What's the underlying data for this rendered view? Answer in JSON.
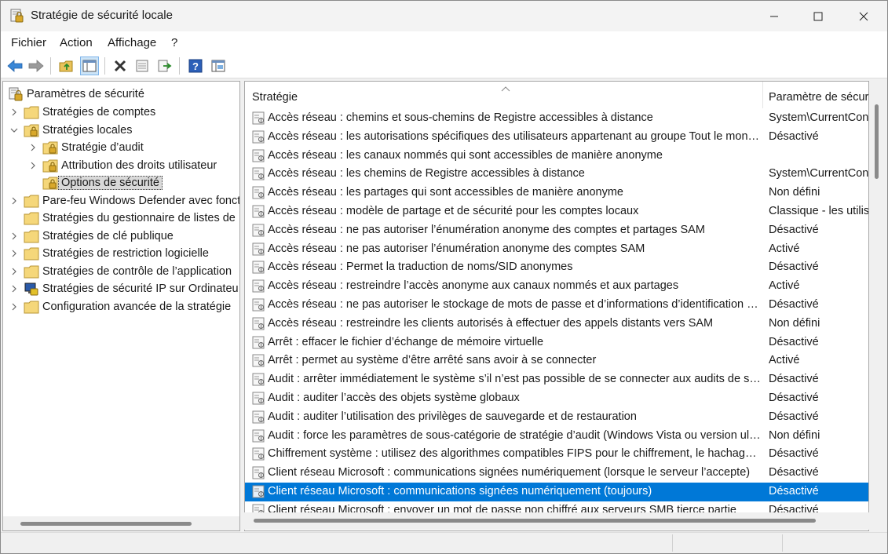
{
  "window": {
    "title": "Stratégie de sécurité locale"
  },
  "menu": [
    "Fichier",
    "Action",
    "Affichage",
    "?"
  ],
  "toolbar": {
    "buttons": [
      "back-arrow-icon",
      "forward-arrow-icon",
      "up-folder-icon",
      "show-hide-tree-icon",
      "delete-icon",
      "properties-icon",
      "export-list-icon",
      "help-icon",
      "console-icon"
    ]
  },
  "tree": {
    "root": "Paramètres de sécurité",
    "items": [
      {
        "label": "Stratégies de comptes",
        "level": 1,
        "expander": "collapsed"
      },
      {
        "label": "Stratégies locales",
        "level": 1,
        "expander": "expanded"
      },
      {
        "label": "Stratégie d’audit",
        "level": 2,
        "expander": "collapsed"
      },
      {
        "label": "Attribution des droits utilisateur",
        "level": 2,
        "expander": "collapsed"
      },
      {
        "label": "Options de sécurité",
        "level": 2,
        "expander": "none",
        "selected": true
      },
      {
        "label": "Pare-feu Windows Defender avec fonct",
        "level": 1,
        "expander": "collapsed"
      },
      {
        "label": "Stratégies du gestionnaire de listes de",
        "level": 1,
        "expander": "none"
      },
      {
        "label": "Stratégies de clé publique",
        "level": 1,
        "expander": "collapsed"
      },
      {
        "label": "Stratégies de restriction logicielle",
        "level": 1,
        "expander": "collapsed"
      },
      {
        "label": "Stratégies de contrôle de l’application",
        "level": 1,
        "expander": "collapsed"
      },
      {
        "label": "Stratégies de sécurité IP sur Ordinateu",
        "level": 1,
        "expander": "collapsed"
      },
      {
        "label": "Configuration avancée de la stratégie",
        "level": 1,
        "expander": "collapsed"
      }
    ]
  },
  "list": {
    "columns": [
      "Stratégie",
      "Paramètre de sécurité"
    ],
    "rows": [
      {
        "policy": "Accès réseau : chemins et sous-chemins de Registre accessibles à distance",
        "setting": "System\\CurrentCont"
      },
      {
        "policy": "Accès réseau : les autorisations spécifiques des utilisateurs appartenant au groupe Tout le mon…",
        "setting": "Désactivé"
      },
      {
        "policy": "Accès réseau : les canaux nommés qui sont accessibles de manière anonyme",
        "setting": ""
      },
      {
        "policy": "Accès réseau : les chemins de Registre accessibles à distance",
        "setting": "System\\CurrentCont"
      },
      {
        "policy": "Accès réseau : les partages qui sont accessibles de manière anonyme",
        "setting": "Non défini"
      },
      {
        "policy": "Accès réseau : modèle de partage et de sécurité pour les comptes locaux",
        "setting": "Classique - les utilis"
      },
      {
        "policy": "Accès réseau : ne pas autoriser l’énumération anonyme des comptes et partages SAM",
        "setting": "Désactivé"
      },
      {
        "policy": "Accès réseau : ne pas autoriser l’énumération anonyme des comptes SAM",
        "setting": "Activé"
      },
      {
        "policy": "Accès réseau : Permet la traduction de noms/SID anonymes",
        "setting": "Désactivé"
      },
      {
        "policy": "Accès réseau : restreindre l’accès anonyme aux canaux nommés et aux partages",
        "setting": "Activé"
      },
      {
        "policy": "Accès réseau : ne pas autoriser le stockage de mots de passe et d’informations d’identification p…",
        "setting": "Désactivé"
      },
      {
        "policy": "Accès réseau : restreindre les clients autorisés à effectuer des appels distants vers SAM",
        "setting": "Non défini"
      },
      {
        "policy": "Arrêt : effacer le fichier d’échange de mémoire virtuelle",
        "setting": "Désactivé"
      },
      {
        "policy": "Arrêt : permet au système d’être arrêté sans avoir à se connecter",
        "setting": "Activé"
      },
      {
        "policy": "Audit : arrêter immédiatement le système s’il n’est pas possible de se connecter aux audits de sé…",
        "setting": "Désactivé"
      },
      {
        "policy": "Audit : auditer l’accès des objets système globaux",
        "setting": "Désactivé"
      },
      {
        "policy": "Audit : auditer l’utilisation des privilèges de sauvegarde et de restauration",
        "setting": "Désactivé"
      },
      {
        "policy": "Audit : force les paramètres de sous-catégorie de stratégie d’audit (Windows Vista ou version ul…",
        "setting": "Non défini"
      },
      {
        "policy": "Chiffrement système : utilisez des algorithmes compatibles FIPS pour le chiffrement, le hachage …",
        "setting": "Désactivé"
      },
      {
        "policy": "Client réseau Microsoft : communications signées numériquement (lorsque le serveur l’accepte)",
        "setting": "Désactivé"
      },
      {
        "policy": "Client réseau Microsoft : communications signées numériquement (toujours)",
        "setting": "Désactivé",
        "selected": true
      },
      {
        "policy": "Client réseau Microsoft : envoyer un mot de passe non chiffré aux serveurs SMB tierce partie",
        "setting": "Désactivé"
      }
    ]
  },
  "colors": {
    "selection": "#0078d7",
    "tree_selection": "#d9d9d9",
    "folder": "#f5d77a",
    "lock": "#c89b1a"
  }
}
